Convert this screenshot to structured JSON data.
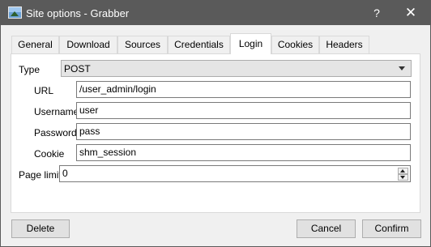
{
  "window": {
    "title": "Site options - Grabber",
    "help_glyph": "?",
    "close_glyph": "✕",
    "icons": {
      "app": "image-icon",
      "help": "help-icon",
      "close": "close-icon"
    }
  },
  "tabs": [
    {
      "label": "General",
      "active": false
    },
    {
      "label": "Download",
      "active": false
    },
    {
      "label": "Sources",
      "active": false
    },
    {
      "label": "Credentials",
      "active": false
    },
    {
      "label": "Login",
      "active": true
    },
    {
      "label": "Cookies",
      "active": false
    },
    {
      "label": "Headers",
      "active": false
    }
  ],
  "form": {
    "type": {
      "label": "Type",
      "value": "POST"
    },
    "url": {
      "label": "URL",
      "value": "/user_admin/login"
    },
    "username": {
      "label": "Username",
      "value": "user"
    },
    "password": {
      "label": "Password",
      "value": "pass"
    },
    "cookie": {
      "label": "Cookie",
      "value": "shm_session"
    },
    "page_limit": {
      "label": "Page limit",
      "value": "0"
    }
  },
  "buttons": {
    "delete": "Delete",
    "cancel": "Cancel",
    "confirm": "Confirm"
  },
  "colors": {
    "titlebar": "#5a5a5a",
    "dialog_bg": "#f0f0f0",
    "panel_bg": "#ffffff",
    "button_bg": "#e1e1e1"
  }
}
